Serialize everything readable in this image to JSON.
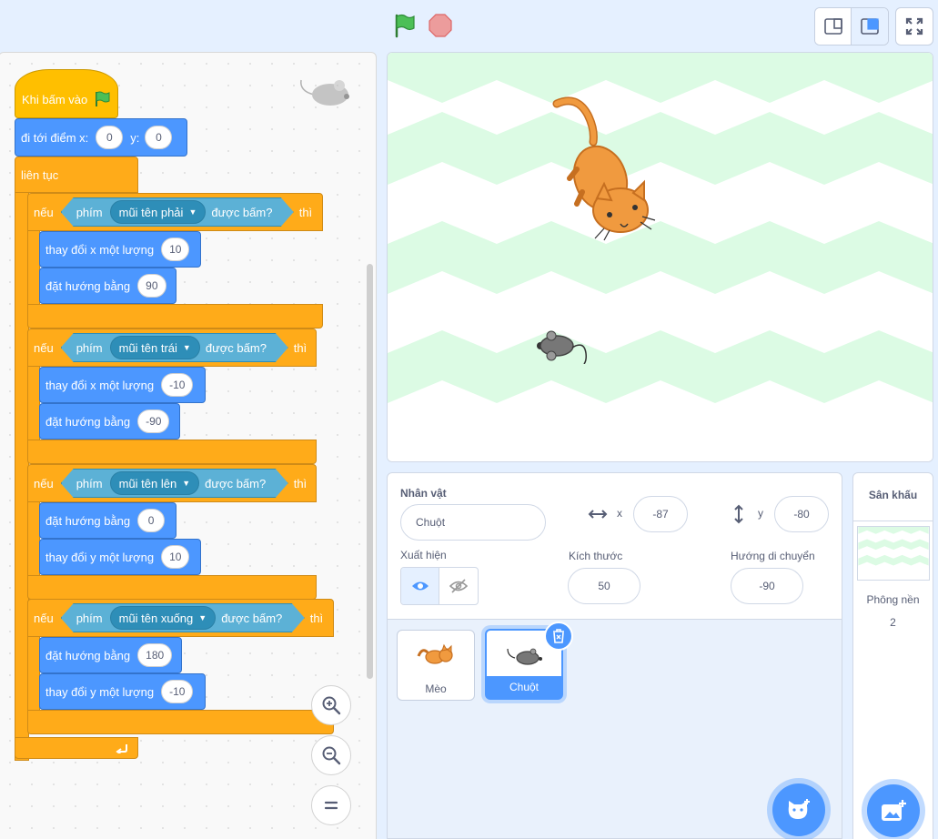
{
  "toolbar": {
    "green_flag": "green-flag-icon",
    "stop": "stop-icon",
    "small_stage": "small-stage-icon",
    "normal_stage": "normal-stage-icon",
    "fullscreen": "fullscreen-icon"
  },
  "colors": {
    "events": "#ffbf00",
    "motion": "#4c97ff",
    "control": "#ffab19",
    "sensing": "#5cb1d6",
    "accent": "#4c97ff"
  },
  "script": {
    "hat": {
      "text": "Khi bấm vào"
    },
    "goto": {
      "text": "đi tới điểm x:",
      "x": "0",
      "y_label": "y:",
      "y": "0"
    },
    "forever": {
      "text": "liên tục"
    },
    "ifs": [
      {
        "if_label": "nếu",
        "key_label": "phím",
        "key": "mũi tên phải",
        "pressed": "được bấm?",
        "then_label": "thì",
        "body": [
          {
            "text": "thay đổi x một lượng",
            "value": "10"
          },
          {
            "text": "đặt hướng bằng",
            "value": "90"
          }
        ]
      },
      {
        "if_label": "nếu",
        "key_label": "phím",
        "key": "mũi tên trái",
        "pressed": "được bấm?",
        "then_label": "thì",
        "body": [
          {
            "text": "thay đổi x một lượng",
            "value": "-10"
          },
          {
            "text": "đặt hướng bằng",
            "value": "-90"
          }
        ]
      },
      {
        "if_label": "nếu",
        "key_label": "phím",
        "key": "mũi tên lên",
        "pressed": "được bấm?",
        "then_label": "thì",
        "body": [
          {
            "text": "đặt hướng bằng",
            "value": "0"
          },
          {
            "text": "thay đổi y một lượng",
            "value": "10"
          }
        ]
      },
      {
        "if_label": "nếu",
        "key_label": "phím",
        "key": "mũi tên xuống",
        "pressed": "được bấm?",
        "then_label": "thì",
        "body": [
          {
            "text": "đặt hướng bằng",
            "value": "180"
          },
          {
            "text": "thay đổi y một lượng",
            "value": "-10"
          }
        ]
      }
    ]
  },
  "sprite_info": {
    "sprite_label": "Nhân vật",
    "sprite_name": "Chuột",
    "x_label": "x",
    "x": "-87",
    "y_label": "y",
    "y": "-80",
    "show_label": "Xuất hiện",
    "size_label": "Kích thước",
    "size": "50",
    "direction_label": "Hướng di chuyển",
    "direction": "-90"
  },
  "sprites": [
    {
      "name": "Mèo",
      "selected": false
    },
    {
      "name": "Chuột",
      "selected": true
    }
  ],
  "stage_panel": {
    "title": "Sân khấu",
    "backdrops_label": "Phông nền",
    "backdrops_count": "2"
  }
}
